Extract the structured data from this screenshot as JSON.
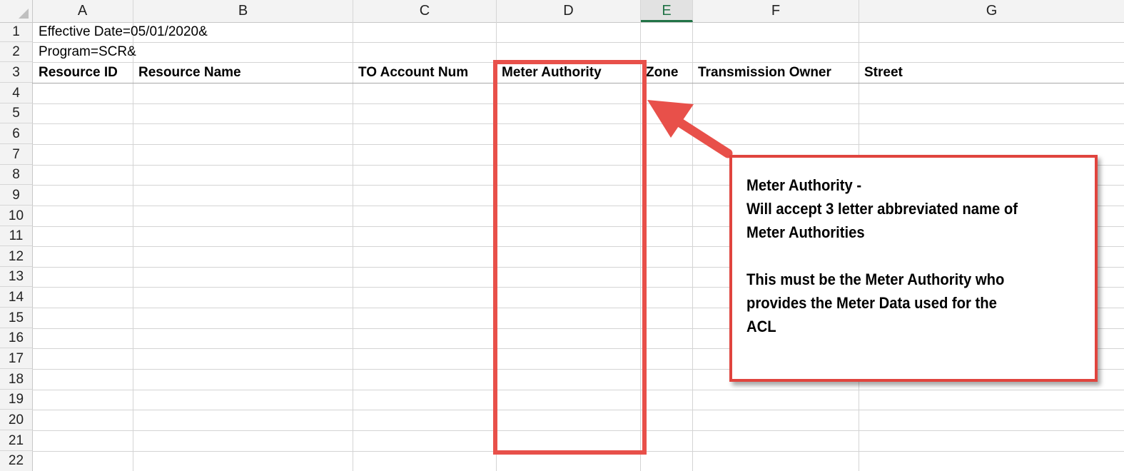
{
  "columns": [
    "A",
    "B",
    "C",
    "D",
    "E",
    "F",
    "G"
  ],
  "selected_column": "E",
  "rows": [
    "1",
    "2",
    "3",
    "4",
    "5",
    "6",
    "7",
    "8",
    "9",
    "10",
    "11",
    "12",
    "13",
    "14",
    "15",
    "16",
    "17",
    "18",
    "19",
    "20",
    "21",
    "22"
  ],
  "cells": {
    "A1": "Effective Date=05/01/2020&",
    "A2": "Program=SCR&",
    "A3": "Resource ID",
    "B3": "Resource Name",
    "C3": "TO Account Num",
    "D3": "Meter Authority",
    "E3": "Zone",
    "F3": "Transmission Owner",
    "G3": "Street"
  },
  "callout": {
    "line1": "Meter Authority -",
    "line2": "Will accept 3 letter abbreviated name of",
    "line3": "Meter Authorities",
    "line4": "This must be the Meter Authority who",
    "line5": "provides the Meter Data used for the",
    "line6": "ACL"
  },
  "colors": {
    "annotation_red": "#e8504a",
    "selected_header_green": "#217346"
  }
}
